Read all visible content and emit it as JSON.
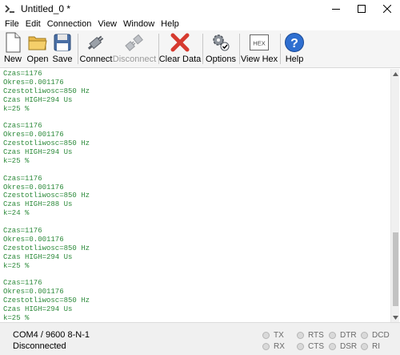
{
  "window": {
    "title": "Untitled_0 *"
  },
  "menu": [
    "File",
    "Edit",
    "Connection",
    "View",
    "Window",
    "Help"
  ],
  "toolbar": {
    "new": "New",
    "open": "Open",
    "save": "Save",
    "connect": "Connect",
    "disconnect": "Disconnect",
    "clear": "Clear Data",
    "options": "Options",
    "viewhex": "View Hex",
    "hex_icon_text": "HEX",
    "help": "Help"
  },
  "terminal": {
    "lines": [
      "Czas=1176",
      "Okres=0.001176",
      "Czestotliwosc=850 Hz",
      "Czas HIGH=294 Us",
      "k=25 %",
      "",
      "Czas=1176",
      "Okres=0.001176",
      "Czestotliwosc=850 Hz",
      "Czas HIGH=294 Us",
      "k=25 %",
      "",
      "Czas=1176",
      "Okres=0.001176",
      "Czestotliwosc=850 Hz",
      "Czas HIGH=288 Us",
      "k=24 %",
      "",
      "Czas=1176",
      "Okres=0.001176",
      "Czestotliwosc=850 Hz",
      "Czas HIGH=294 Us",
      "k=25 %",
      "",
      "Czas=1176",
      "Okres=0.001176",
      "Czestotliwosc=850 Hz",
      "Czas HIGH=294 Us",
      "k=25 %"
    ],
    "text_color": "#2e8b3c"
  },
  "status": {
    "port": "COM4 / 9600 8-N-1",
    "connection": "Disconnected",
    "indicators": {
      "tx": "TX",
      "rx": "RX",
      "rts": "RTS",
      "cts": "CTS",
      "dtr": "DTR",
      "dsr": "DSR",
      "dcd": "DCD",
      "ri": "RI"
    }
  }
}
